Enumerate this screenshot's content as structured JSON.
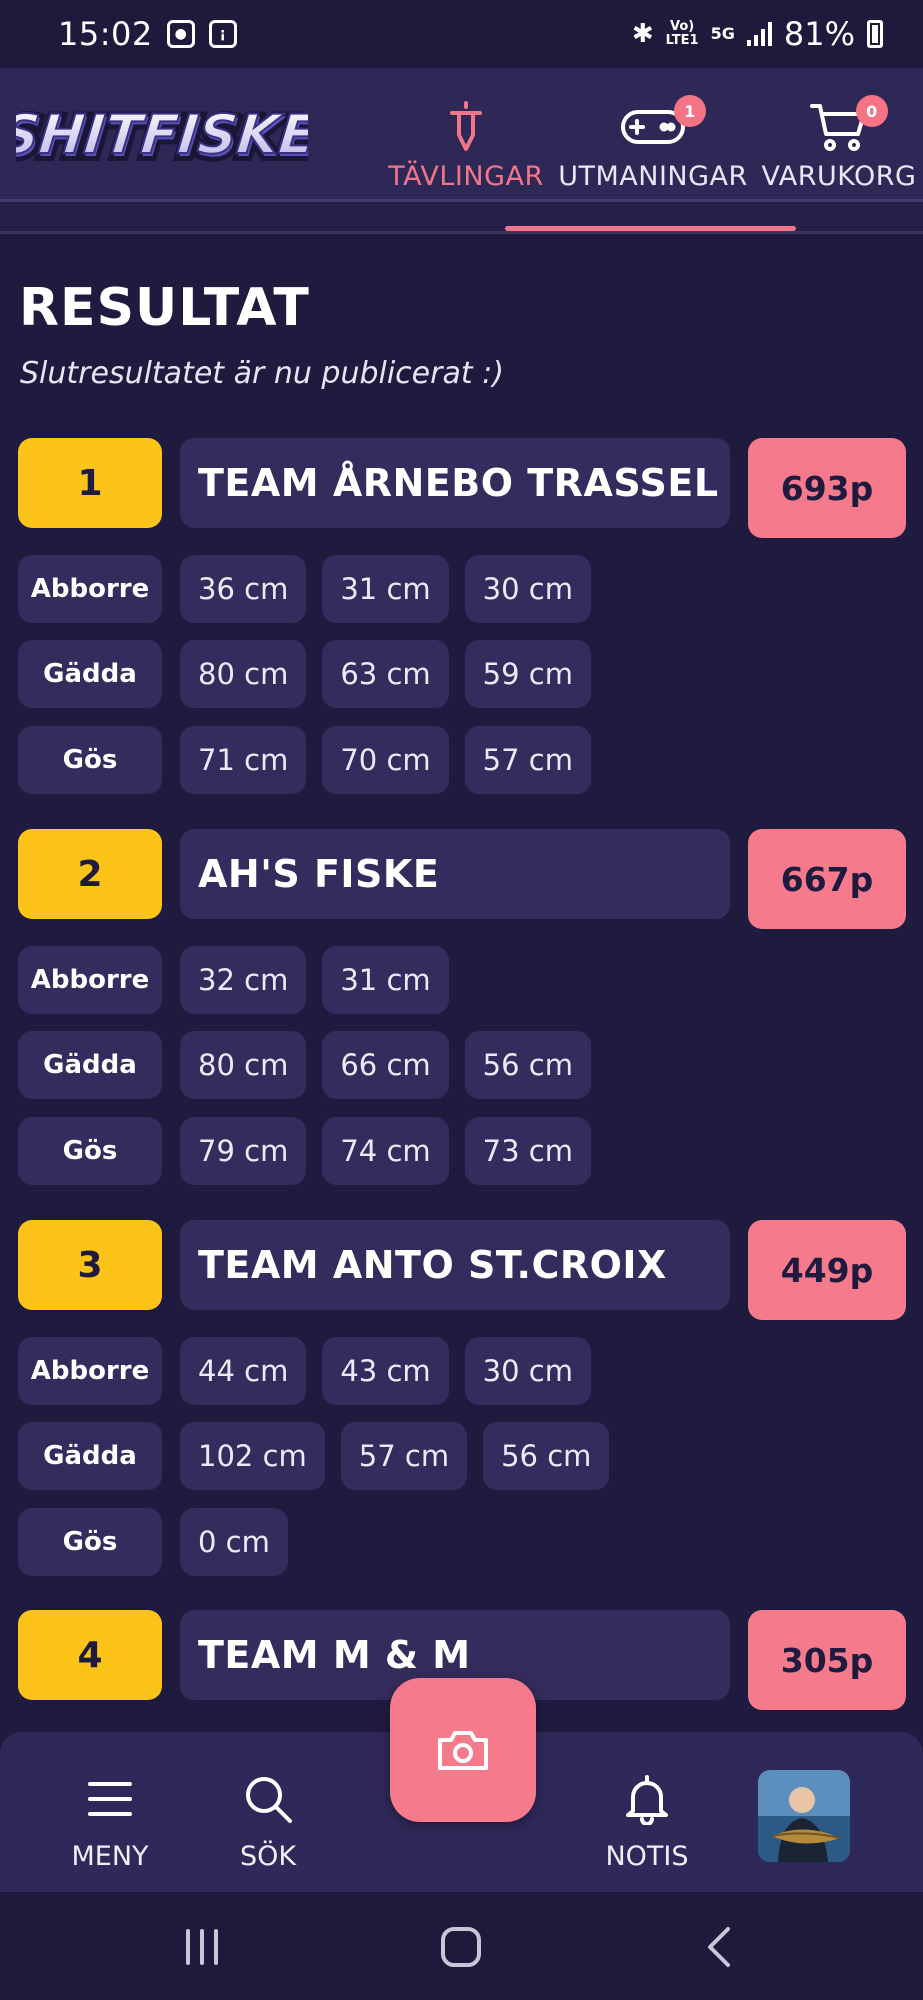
{
  "status_bar": {
    "time": "15:02",
    "network_top": "Vo)",
    "network_bottom": "LTE1",
    "network_5g": "5G",
    "battery": "81%"
  },
  "header": {
    "logo_text": "SHITFISKE",
    "nav": [
      {
        "label": "TÄVLINGAR",
        "icon": "sword-icon",
        "active": true
      },
      {
        "label": "UTMANINGAR",
        "icon": "gamepad-icon",
        "badge": "1"
      },
      {
        "label": "VARUKORG",
        "icon": "cart-icon",
        "badge": "0"
      }
    ]
  },
  "page": {
    "title": "RESULTAT",
    "subtitle": "Slutresultatet är nu publicerat :)"
  },
  "results": [
    {
      "rank": "1",
      "team": "TEAM ÅRNEBO TRASSEL",
      "score": "693p",
      "species": [
        {
          "name": "Abborre",
          "catches": [
            "36 cm",
            "31 cm",
            "30 cm"
          ]
        },
        {
          "name": "Gädda",
          "catches": [
            "80 cm",
            "63 cm",
            "59 cm"
          ]
        },
        {
          "name": "Gös",
          "catches": [
            "71 cm",
            "70 cm",
            "57 cm"
          ]
        }
      ]
    },
    {
      "rank": "2",
      "team": "AH'S FISKE",
      "score": "667p",
      "species": [
        {
          "name": "Abborre",
          "catches": [
            "32 cm",
            "31 cm"
          ]
        },
        {
          "name": "Gädda",
          "catches": [
            "80 cm",
            "66 cm",
            "56 cm"
          ]
        },
        {
          "name": "Gös",
          "catches": [
            "79 cm",
            "74 cm",
            "73 cm"
          ]
        }
      ]
    },
    {
      "rank": "3",
      "team": "TEAM ANTO ST.CROIX",
      "score": "449p",
      "species": [
        {
          "name": "Abborre",
          "catches": [
            "44 cm",
            "43 cm",
            "30 cm"
          ]
        },
        {
          "name": "Gädda",
          "catches": [
            "102 cm",
            "57 cm",
            "56 cm"
          ]
        },
        {
          "name": "Gös",
          "catches": [
            "0 cm"
          ]
        }
      ]
    },
    {
      "rank": "4",
      "team": "TEAM M & M",
      "score": "305p",
      "species": []
    }
  ],
  "bottom_nav": {
    "menu": "MENY",
    "search": "SÖK",
    "camera_icon": "camera-icon",
    "notis": "NOTIS",
    "avatar_icon": "profile-avatar"
  },
  "colors": {
    "background": "#1f1b3e",
    "card": "#332c5c",
    "accent_pink": "#f57b8c",
    "rank_yellow": "#fcc419"
  }
}
